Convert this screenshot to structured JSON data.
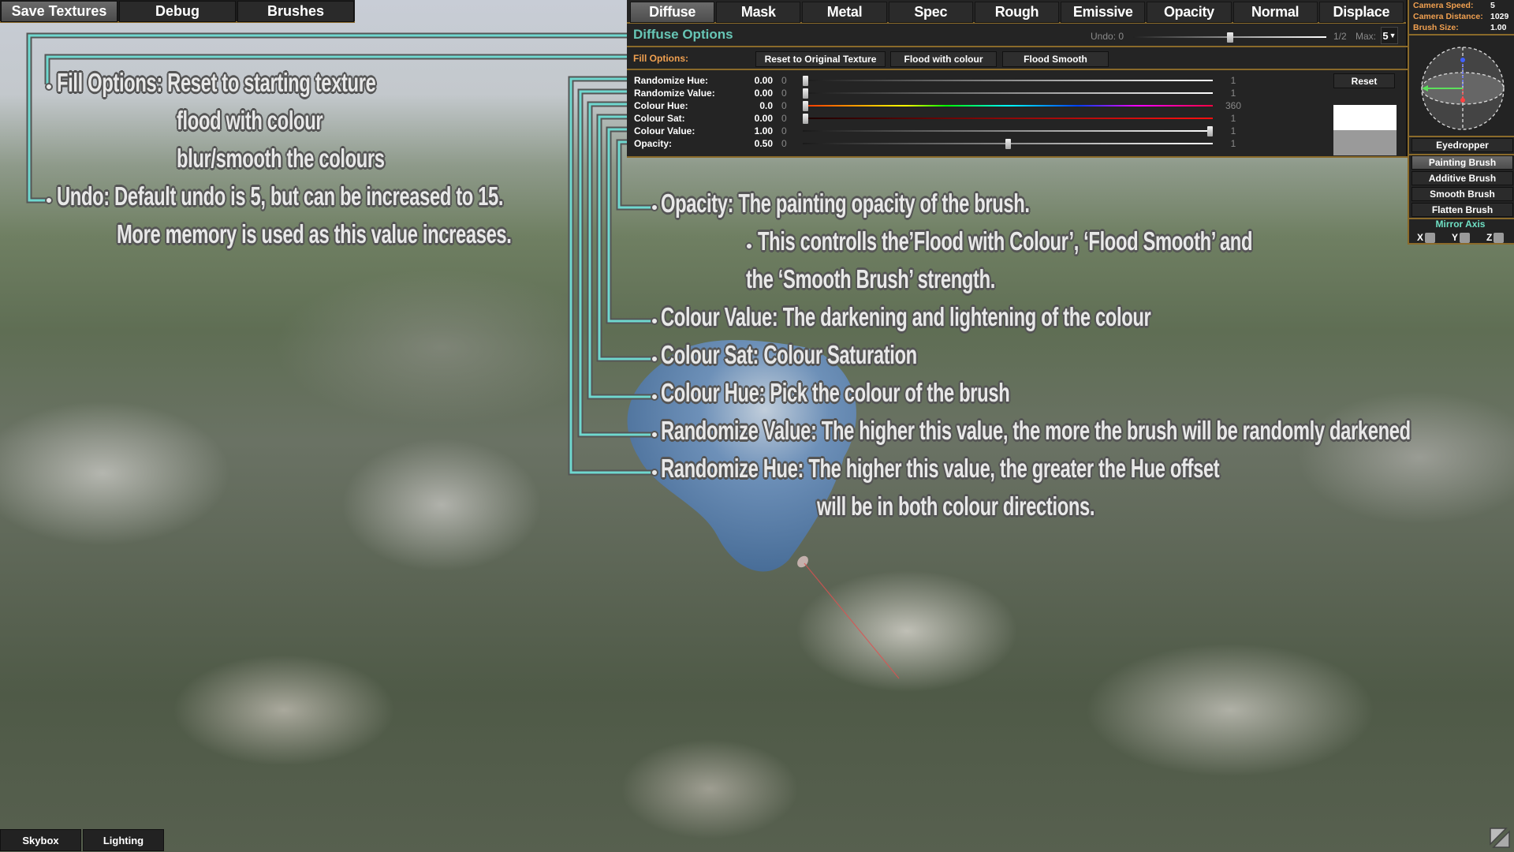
{
  "top_nav": {
    "buttons": [
      {
        "label": "Save Textures",
        "active": true
      },
      {
        "label": "Debug",
        "active": false
      },
      {
        "label": "Brushes",
        "active": false
      }
    ]
  },
  "panel": {
    "tabs": [
      {
        "label": "Diffuse",
        "active": true
      },
      {
        "label": "Mask",
        "active": false
      },
      {
        "label": "Metal",
        "active": false
      },
      {
        "label": "Spec",
        "active": false
      },
      {
        "label": "Rough",
        "active": false
      },
      {
        "label": "Emissive",
        "active": false
      },
      {
        "label": "Opacity",
        "active": false
      },
      {
        "label": "Normal",
        "active": false
      },
      {
        "label": "Displace",
        "active": false
      }
    ],
    "section_title": "Diffuse Options",
    "undo": {
      "label": "Undo: 0",
      "position_fraction": 0.5,
      "fraction_label": "1/2",
      "max_label": "Max:",
      "max_value": "5"
    },
    "fill": {
      "label": "Fill Options:",
      "buttons": [
        "Reset to Original Texture",
        "Flood with colour",
        "Flood Smooth"
      ]
    },
    "sliders": [
      {
        "label": "Randomize Hue:",
        "value": "0.00",
        "min": "0",
        "max": "1",
        "fraction": 0.0,
        "track": "gray"
      },
      {
        "label": "Randomize Value:",
        "value": "0.00",
        "min": "0",
        "max": "1",
        "fraction": 0.0,
        "track": "gray"
      },
      {
        "label": "Colour Hue:",
        "value": "0.0",
        "min": "0",
        "max": "360",
        "fraction": 0.0,
        "track": "hue"
      },
      {
        "label": "Colour Sat:",
        "value": "0.00",
        "min": "0",
        "max": "1",
        "fraction": 0.0,
        "track": "sat"
      },
      {
        "label": "Colour Value:",
        "value": "1.00",
        "min": "0",
        "max": "1",
        "fraction": 1.0,
        "track": "gray"
      },
      {
        "label": "Opacity:",
        "value": "0.50",
        "min": "0",
        "max": "1",
        "fraction": 0.5,
        "track": "gray"
      }
    ],
    "reset_label": "Reset",
    "swatch": {
      "new_color": "#ffffff",
      "old_color": "#9a9a9a"
    }
  },
  "right_panel": {
    "stats": [
      {
        "label": "Camera Speed:",
        "value": "5"
      },
      {
        "label": "Camera Distance:",
        "value": "1029"
      },
      {
        "label": "Brush Size:",
        "value": "1.00"
      }
    ],
    "buttons": [
      {
        "label": "Eyedropper",
        "active": false
      },
      {
        "label": "Painting Brush",
        "active": true
      },
      {
        "label": "Additive Brush",
        "active": false
      },
      {
        "label": "Smooth Brush",
        "active": false
      },
      {
        "label": "Flatten Brush",
        "active": false
      }
    ],
    "mirror_axis": {
      "title": "Mirror Axis",
      "axes": [
        "X",
        "Y",
        "Z"
      ]
    }
  },
  "bottom_buttons": [
    "Skybox",
    "Lighting"
  ],
  "annotations": {
    "left": [
      "Fill Options: Reset to starting texture",
      "flood with colour",
      "blur/smooth the colours",
      "Undo: Default undo is 5, but can be increased to 15.",
      "More memory is used as this value increases."
    ],
    "right": [
      "Opacity: The painting opacity of the brush.",
      "This controlls the’Flood with Colour’, ‘Flood Smooth’ and",
      "the ‘Smooth Brush’ strength.",
      "Colour Value: The darkening and lightening of the colour",
      "Colour Sat: Colour Saturation",
      "Colour Hue: Pick the colour of the brush",
      "Randomize Value: The higher this value, the more the brush will be randomly darkened",
      "Randomize Hue: The higher this value, the greater the Hue offset",
      "will be in both colour directions."
    ]
  },
  "colors": {
    "accent_gold": "#8a6a2a",
    "label_orange": "#f0a050",
    "leader_cyan": "#6fd8cf",
    "mirror_teal": "#6fe0c4"
  }
}
